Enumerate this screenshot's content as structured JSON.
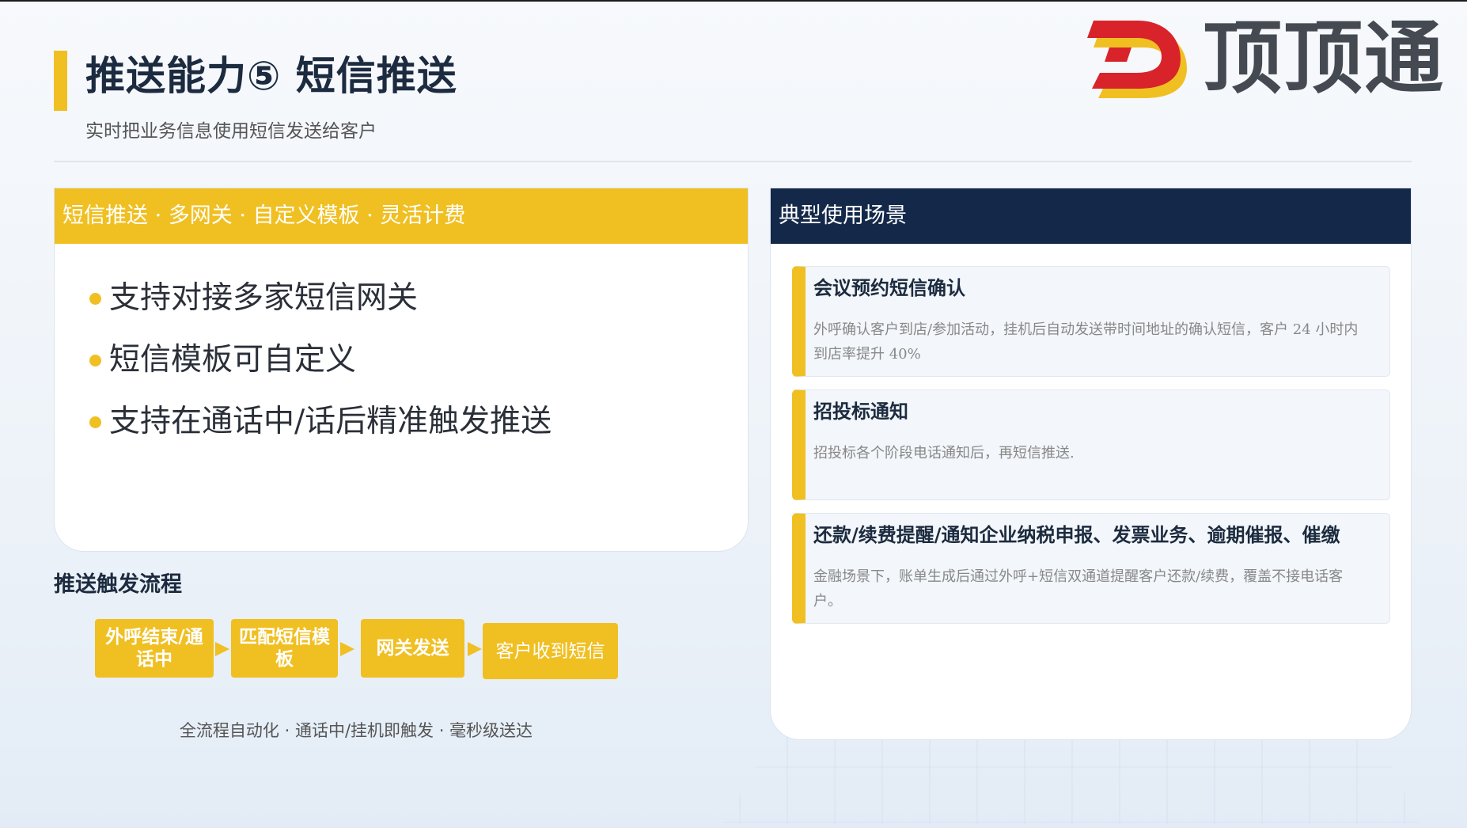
{
  "header": {
    "title": "推送能力⑤ 短信推送",
    "subtitle": "实时把业务信息使用短信发送给客户",
    "logo_text": "顶顶通",
    "accent_color": "#f0bf22",
    "navy_color": "#14294a"
  },
  "features_card": {
    "header": "短信推送 · 多网关 · 自定义模板 · 灵活计费",
    "bullets": [
      "支持对接多家短信网关",
      "短信模板可自定义",
      "支持在通话中/话后精准触发推送"
    ]
  },
  "flow": {
    "title": "推送触发流程",
    "steps": [
      "外呼结束/通话中",
      "匹配短信模板",
      "网关发送",
      "客户收到短信"
    ],
    "note": "全流程自动化 · 通话中/挂机即触发 · 毫秒级送达"
  },
  "scenes_card": {
    "header": "典型使用场景",
    "items": [
      {
        "title": "会议预约短信确认",
        "desc": "外呼确认客户到店/参加活动，挂机后自动发送带时间地址的确认短信，客户 24 小时内到店率提升 40%"
      },
      {
        "title": "招投标通知",
        "desc": "招投标各个阶段电话通知后，再短信推送."
      },
      {
        "title": "还款/续费提醒/通知企业纳税申报、发票业务、逾期催报、催缴",
        "desc": "金融场景下，账单生成后通过外呼+短信双通道提醒客户还款/续费，覆盖不接电话客户。"
      }
    ]
  }
}
